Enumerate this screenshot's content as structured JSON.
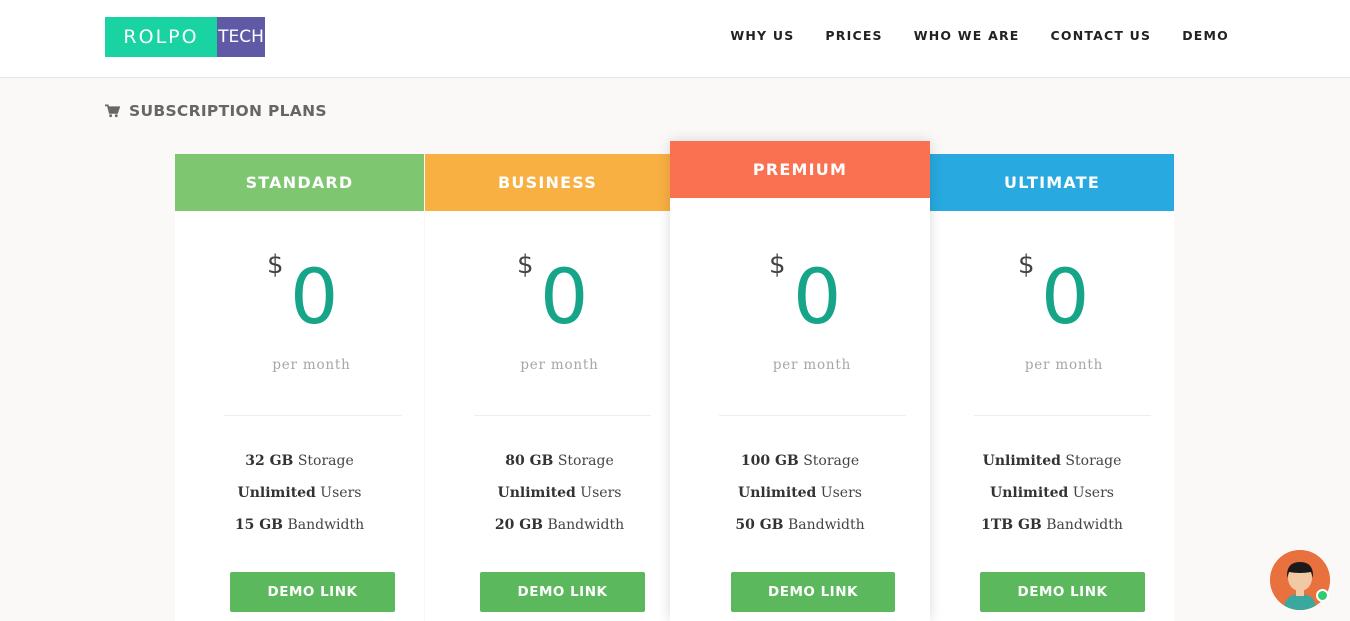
{
  "header": {
    "logo_left": "ROLPO",
    "logo_right": "TECH",
    "nav": [
      "WHY US",
      "PRICES",
      "WHO WE ARE",
      "CONTACT US",
      "DEMO"
    ]
  },
  "section": {
    "icon": "cart-icon",
    "title": "SUBSCRIPTION PLANS"
  },
  "colors": {
    "standard": "#7ec66f",
    "business": "#f9b042",
    "premium": "#f97150",
    "ultimate": "#28a9e0",
    "price": "#17a589",
    "button": "#5cb85c"
  },
  "plans": [
    {
      "name": "STANDARD",
      "currency": "$",
      "amount": "0",
      "period": "per month",
      "features": [
        {
          "bold": "32 GB",
          "text": " Storage"
        },
        {
          "bold": "Unlimited",
          "text": " Users"
        },
        {
          "bold": "15 GB",
          "text": " Bandwidth"
        }
      ],
      "button": "DEMO LINK"
    },
    {
      "name": "BUSINESS",
      "currency": "$",
      "amount": "0",
      "period": "per month",
      "features": [
        {
          "bold": "80 GB",
          "text": " Storage"
        },
        {
          "bold": "Unlimited",
          "text": " Users"
        },
        {
          "bold": "20 GB",
          "text": " Bandwidth"
        }
      ],
      "button": "DEMO LINK"
    },
    {
      "name": "PREMIUM",
      "currency": "$",
      "amount": "0",
      "period": "per month",
      "features": [
        {
          "bold": "100 GB",
          "text": " Storage"
        },
        {
          "bold": "Unlimited",
          "text": " Users"
        },
        {
          "bold": "50 GB",
          "text": " Bandwidth"
        }
      ],
      "button": "DEMO LINK"
    },
    {
      "name": "ULTIMATE",
      "currency": "$",
      "amount": "0",
      "period": "per month",
      "features": [
        {
          "bold": "Unlimited",
          "text": " Storage"
        },
        {
          "bold": "Unlimited",
          "text": " Users"
        },
        {
          "bold": "1TB GB",
          "text": " Bandwidth"
        }
      ],
      "button": "DEMO LINK"
    }
  ],
  "chat": {
    "icon": "chat-avatar-icon"
  }
}
